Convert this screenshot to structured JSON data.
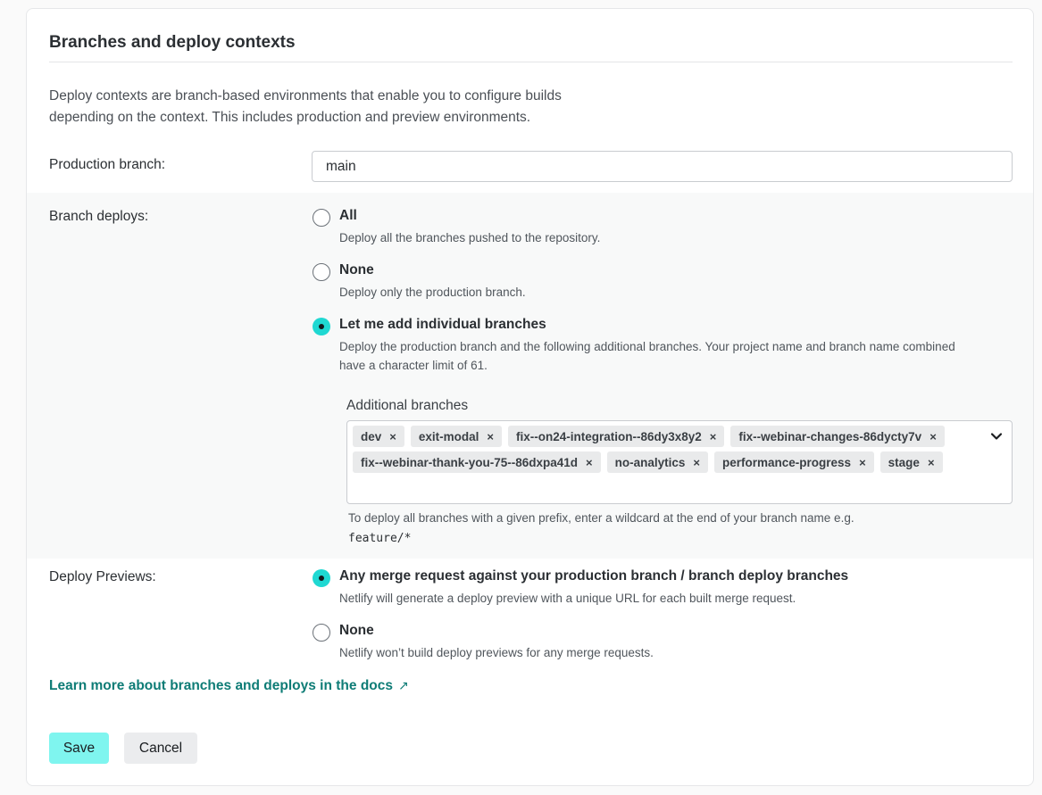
{
  "section": {
    "title": "Branches and deploy contexts",
    "intro_line1": "Deploy contexts are branch-based environments that enable you to configure builds",
    "intro_line2": "depending on the context. This includes production and preview environments."
  },
  "production_branch": {
    "label": "Production branch:",
    "value": "main"
  },
  "branch_deploys": {
    "label": "Branch deploys:",
    "selected": "individual",
    "options": [
      {
        "id": "all",
        "label": "All",
        "description": "Deploy all the branches pushed to the repository."
      },
      {
        "id": "none",
        "label": "None",
        "description": "Deploy only the production branch."
      },
      {
        "id": "individual",
        "label": "Let me add individual branches",
        "description_line1": "Deploy the production branch and the following additional branches. Your project name and branch name combined",
        "description_line2": "have a character limit of 61."
      }
    ],
    "additional_branches": {
      "label": "Additional branches",
      "tags": [
        "dev",
        "exit-modal",
        "fix--on24-integration--86dy3x8y2",
        "fix--webinar-changes-86dycty7v",
        "fix--webinar-thank-you-75--86dxpa41d",
        "no-analytics",
        "performance-progress",
        "stage"
      ],
      "remove_symbol": "×",
      "hint_text": "To deploy all branches with a given prefix, enter a wildcard at the end of your branch name e.g.",
      "hint_code": "feature/*"
    }
  },
  "deploy_previews": {
    "label": "Deploy Previews:",
    "selected": "any_merge_request",
    "options": [
      {
        "id": "any_merge_request",
        "label": "Any merge request against your production branch / branch deploy branches",
        "description": "Netlify will generate a deploy preview with a unique URL for each built merge request."
      },
      {
        "id": "none",
        "label": "None",
        "description": "Netlify won’t build deploy previews for any merge requests."
      }
    ]
  },
  "docs_link": {
    "label": "Learn more about branches and deploys in the docs",
    "arrow": "↗"
  },
  "actions": {
    "save_label": "Save",
    "cancel_label": "Cancel"
  },
  "colors": {
    "accent": "#1fd8d2",
    "save_button": "#7ff5ef",
    "link": "#0e7c76",
    "tag_background": "#e9eaeb"
  }
}
